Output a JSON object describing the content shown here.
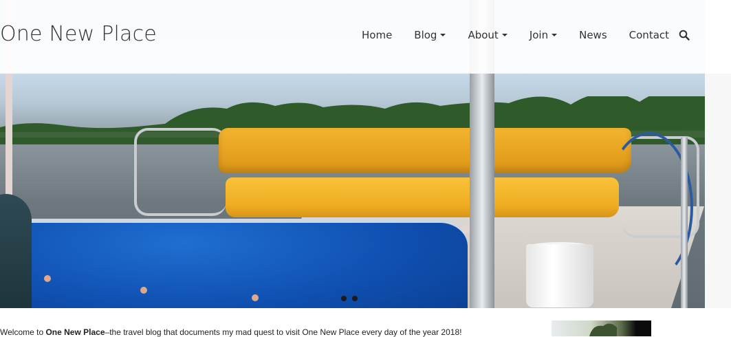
{
  "header": {
    "site_title": "One New Place",
    "nav": [
      {
        "label": "Home",
        "dropdown": false
      },
      {
        "label": "Blog",
        "dropdown": true
      },
      {
        "label": "About",
        "dropdown": true
      },
      {
        "label": "Join",
        "dropdown": true
      },
      {
        "label": "News",
        "dropdown": false
      },
      {
        "label": "Contact",
        "dropdown": false
      }
    ],
    "search_icon": "search-icon"
  },
  "hero": {
    "slide_count": 2,
    "active_slide": 1
  },
  "content": {
    "welcome_prefix": "Welcome to ",
    "welcome_bold": "One New Place",
    "welcome_suffix": "–the travel blog that documents my mad quest to visit One New Place every day of the year 2018!"
  },
  "colors": {
    "nav_text": "#333333",
    "cushion_yellow": "#efac21",
    "seat_blue": "#0f4fb0"
  }
}
